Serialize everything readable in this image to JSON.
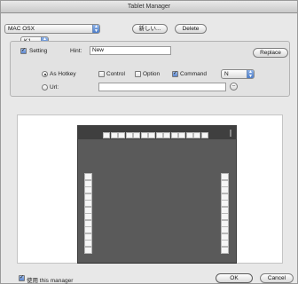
{
  "window": {
    "title": "Tablet Manager"
  },
  "toolbar": {
    "device_select": "MAC OSX",
    "new_button": "新しい...",
    "delete_button": "Delete"
  },
  "key_select": "K1",
  "setting": {
    "label": "Setting",
    "checked": true
  },
  "hint": {
    "label": "Hint:",
    "value": "New"
  },
  "replace_button": "Replace",
  "as_hotkey": {
    "radio_label": "As Hotkey",
    "control_label": "Control",
    "control_checked": false,
    "option_label": "Option",
    "option_checked": false,
    "command_label": "Command",
    "command_checked": true,
    "key_value": "N"
  },
  "url": {
    "radio_label": "Url:",
    "value": ""
  },
  "footer": {
    "use_manager_label": "使用 this manager",
    "use_manager_checked": true,
    "ok_button": "OK",
    "cancel_button": "Cancel"
  },
  "colors": {
    "tablet_body": "#5a5a5a",
    "accent_blue": "#5c86cf"
  },
  "tablet": {
    "top_keys": 14,
    "left_keys": 12,
    "right_keys": 12
  }
}
